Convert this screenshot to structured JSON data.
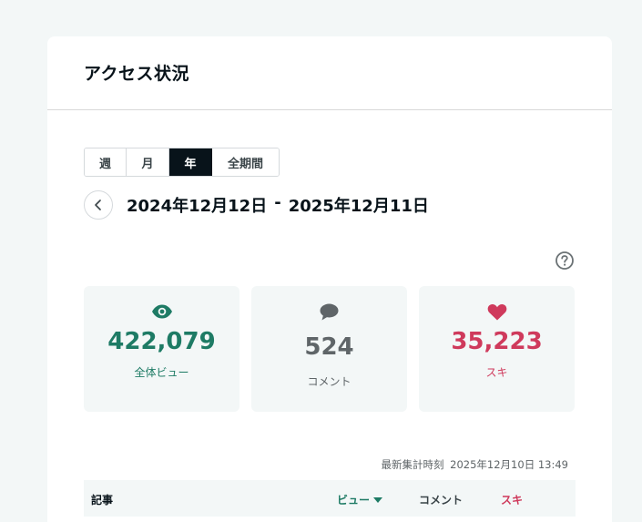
{
  "header": {
    "title": "アクセス状況"
  },
  "period_tabs": [
    {
      "label": "週",
      "active": false
    },
    {
      "label": "月",
      "active": false
    },
    {
      "label": "年",
      "active": true
    },
    {
      "label": "全期間",
      "active": false
    }
  ],
  "range": {
    "start": "2024年12月12日",
    "separator": "-",
    "end": "2025年12月11日"
  },
  "stats": {
    "views": {
      "value": "422,079",
      "label": "全体ビュー",
      "icon": "eye-icon",
      "color": "#1e7b65"
    },
    "comments": {
      "value": "524",
      "label": "コメント",
      "icon": "comment-icon",
      "color": "#5f6568"
    },
    "likes": {
      "value": "35,223",
      "label": "スキ",
      "icon": "heart-icon",
      "color": "#cf3a5c"
    }
  },
  "updated": {
    "label": "最新集計時刻",
    "time": "2025年12月10日 13:49"
  },
  "table": {
    "columns": {
      "article": "記事",
      "views": "ビュー",
      "comments": "コメント",
      "likes": "スキ"
    }
  }
}
